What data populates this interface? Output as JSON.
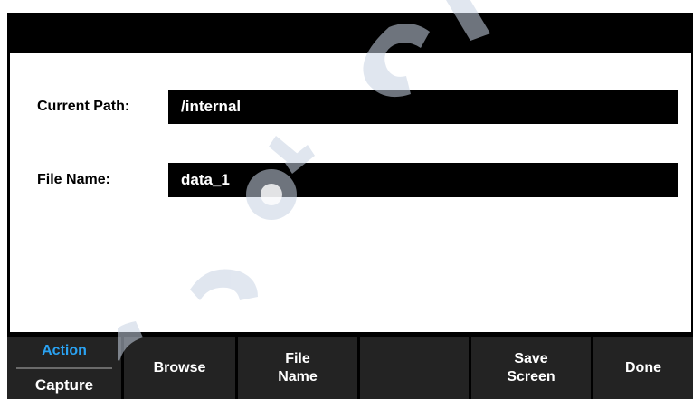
{
  "form": {
    "path_label": "Current Path:",
    "path_value": "/internal",
    "name_label": "File Name:",
    "name_value": "data_1"
  },
  "softkeys": {
    "action_label": "Action",
    "capture_label": "Capture",
    "browse_label": "Browse",
    "filename_line1": "File",
    "filename_line2": "Name",
    "empty_label": "",
    "savescreen_line1": "Save",
    "savescreen_line2": "Screen",
    "done_label": "Done"
  },
  "colors": {
    "accent": "#2aa2f2",
    "softkey_bg": "#232323",
    "watermark": "#c8d3e3"
  }
}
